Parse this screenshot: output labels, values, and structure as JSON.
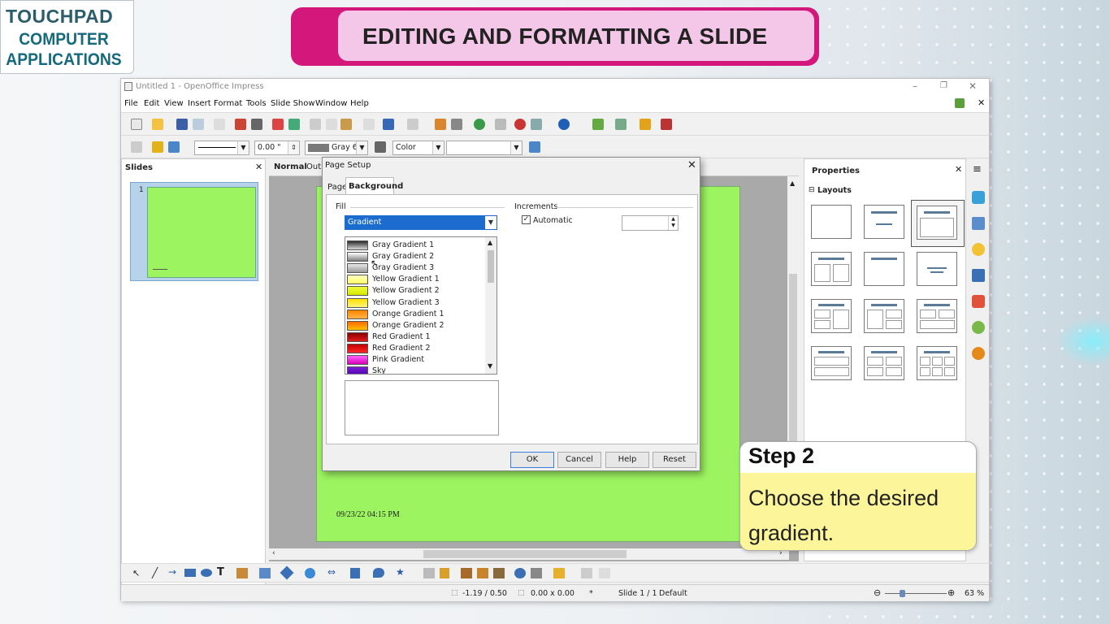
{
  "logo": {
    "brand": "TOUCHPAD",
    "line1": "COMPUTER",
    "line2": "APPLICATIONS"
  },
  "banner": {
    "title": "EDITING AND FORMATTING A SLIDE"
  },
  "window": {
    "title": "Untitled 1 - OpenOffice Impress",
    "controls": {
      "minimize": "–",
      "restore": "❐",
      "close": "✕"
    },
    "menu": [
      "File",
      "Edit",
      "View",
      "Insert",
      "Format",
      "Tools",
      "Slide Show",
      "Window",
      "Help"
    ]
  },
  "toolbar2": {
    "line_width": "0.00 \"",
    "color_name": "Gray 6",
    "fill_type": "Color"
  },
  "slides_panel": {
    "title": "Slides",
    "slide_number": "1"
  },
  "view_tabs": {
    "normal": "Normal",
    "outline": "Outl"
  },
  "slide": {
    "footer_date": "09/23/22 04:15 PM"
  },
  "properties": {
    "title": "Properties",
    "section": "Layouts"
  },
  "dialog": {
    "title": "Page Setup",
    "tabs": [
      "Page",
      "Background"
    ],
    "fill_label": "Fill",
    "fill_value": "Gradient",
    "increments_label": "Increments",
    "automatic_label": "Automatic",
    "gradients": [
      {
        "name": "Gray Gradient 1",
        "c1": "#2b2b2b",
        "c2": "#d8d8d8"
      },
      {
        "name": "Gray Gradient 2",
        "c1": "#ffffff",
        "c2": "#7f7f7f"
      },
      {
        "name": "Gray Gradient 3",
        "c1": "#e8e8e8",
        "c2": "#9a9a9a"
      },
      {
        "name": "Yellow Gradient 1",
        "c1": "#ffffc0",
        "c2": "#ffff66"
      },
      {
        "name": "Yellow Gradient 2",
        "c1": "#f0ff3a",
        "c2": "#d4e800"
      },
      {
        "name": "Yellow Gradient 3",
        "c1": "#ffe200",
        "c2": "#fff37a"
      },
      {
        "name": "Orange Gradient 1",
        "c1": "#ff8400",
        "c2": "#ffb347"
      },
      {
        "name": "Orange Gradient 2",
        "c1": "#ff6a00",
        "c2": "#ffc000"
      },
      {
        "name": "Red Gradient 1",
        "c1": "#8c0000",
        "c2": "#e01b1b"
      },
      {
        "name": "Red Gradient 2",
        "c1": "#c40000",
        "c2": "#ff2626"
      },
      {
        "name": "Pink Gradient",
        "c1": "#ff62ff",
        "c2": "#d800b8"
      },
      {
        "name": "Sky",
        "c1": "#7a1fd6",
        "c2": "#4d00ad"
      }
    ],
    "buttons": {
      "ok": "OK",
      "cancel": "Cancel",
      "help": "Help",
      "reset": "Reset"
    }
  },
  "statusbar": {
    "position": "-1.19 / 0.50",
    "size": "0.00 x 0.00",
    "star": "*",
    "slide": "Slide 1 / 1",
    "layout": "Default",
    "zoom": "63 %"
  },
  "step": {
    "heading": "Step 2",
    "body": "Choose the desired gradient."
  },
  "colors": {
    "slide_green": "#9cf460",
    "banner_magenta": "#d4187b",
    "banner_pink": "#f4c7e8",
    "step_yellow": "#fdf59a",
    "selection_blue": "#1c6ccf"
  }
}
